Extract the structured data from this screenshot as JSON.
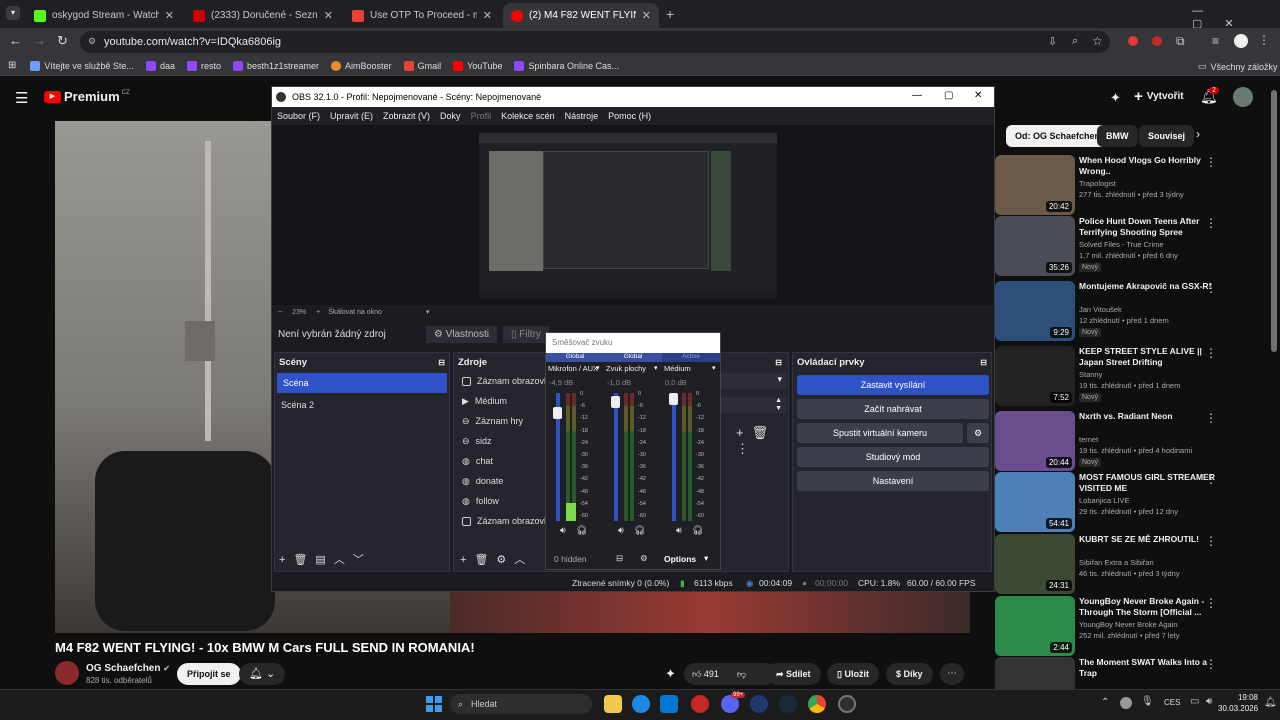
{
  "browser": {
    "tabs": [
      {
        "title": "oskygod Stream - Watch Live o",
        "color": "#53fc18",
        "active": false
      },
      {
        "title": "(2333) Doručené - Seznam Ema",
        "color": "#cc0000",
        "active": false
      },
      {
        "title": "Use OTP To Proceed - milandik",
        "color": "#ea4335",
        "active": false
      },
      {
        "title": "(2) M4 F82 WENT FLYING! - 10x",
        "color": "#ff0000",
        "active": true
      }
    ],
    "url": "youtube.com/watch?v=IDQka6806ig",
    "bookmarks": [
      {
        "label": "Vítejte ve službě Ste...",
        "color": "#6aa0ff"
      },
      {
        "label": "daa",
        "color": "#9146ff"
      },
      {
        "label": "resto",
        "color": "#9146ff"
      },
      {
        "label": "besth1z1streamer",
        "color": "#9146ff"
      },
      {
        "label": "AimBooster",
        "color": "#f28c28"
      },
      {
        "label": "Gmail",
        "color": "#ea4335"
      },
      {
        "label": "YouTube",
        "color": "#ff0000"
      },
      {
        "label": "Spinbara Online Cas...",
        "color": "#9146ff"
      }
    ],
    "all_bookmarks": "Všechny záložky"
  },
  "youtube": {
    "logo": "Premium",
    "logo_sup": "CZ",
    "create": "Vytvořit",
    "notif_count": "2",
    "chips": [
      "Od: OG Schaefchen",
      "BMW",
      "Souvisej"
    ],
    "video_title": "M4 F82 WENT FLYING! - 10x BMW M Cars FULL SEND IN ROMANIA!",
    "channel": "OG Schaefchen",
    "subscribers": "828 tis. odběratelů",
    "join": "Připojit se",
    "likes": "491",
    "share": "Sdílet",
    "save": "Uložit",
    "thanks": "Díky",
    "recommendations": [
      {
        "title": "When Hood Vlogs Go Horribly Wrong..",
        "channel": "Trapologist",
        "meta": "277 tis. zhlédnutí • před 3 týdny",
        "duration": "20:42",
        "badge": "",
        "color": "#6b5a4a"
      },
      {
        "title": "Police Hunt Down Teens After Terrifying Shooting Spree",
        "channel": "Solved Files - True Crime",
        "meta": "1,7 mil. zhlédnutí • před 6 dny",
        "duration": "35:26",
        "badge": "Nový",
        "color": "#4a4d55"
      },
      {
        "title": "Montujeme Akrapovič na GSX-R!",
        "channel": "Jan Vitoušek",
        "meta": "12 zhlédnutí • před 1 dnem",
        "duration": "9:29",
        "badge": "Nový",
        "color": "#2d4f7a"
      },
      {
        "title": "KEEP STREET STYLE ALIVE || Japan Street Drifting",
        "channel": "Stanny",
        "meta": "19 tis. zhlédnutí • před 1 dnem",
        "duration": "7:52",
        "badge": "Nový",
        "color": "#222"
      },
      {
        "title": "Nxrth vs. Radiant Neon",
        "channel": "ternet",
        "meta": "19 tis. zhlédnutí • před 4 hodinami",
        "duration": "20:44",
        "badge": "Nový",
        "color": "#6a4d8f"
      },
      {
        "title": "MOST FAMOUS GIRL STREAMER VISITED ME",
        "channel": "Lobanjica LIVE",
        "meta": "29 tis. zhlédnutí • před 12 dny",
        "duration": "54:41",
        "badge": "",
        "color": "#4e7fb8"
      },
      {
        "title": "KUBRT SE ZE MĚ ZHROUTIL!",
        "channel": "Sibiřan Extra a Sibiřan",
        "meta": "46 tis. zhlédnutí • před 3 týdny",
        "duration": "24:31",
        "badge": "",
        "color": "#3c4a35"
      },
      {
        "title": "YoungBoy Never Broke Again - Through The Storm [Official ...",
        "channel": "YoungBoy Never Broke Again",
        "meta": "252 mil. zhlédnutí • před 7 lety",
        "duration": "2:44",
        "badge": "",
        "color": "#2c8a4a"
      },
      {
        "title": "The Moment SWAT Walks Into a Trap",
        "channel": "",
        "meta": "",
        "duration": "",
        "badge": "",
        "color": "#333"
      }
    ]
  },
  "obs": {
    "title": "OBS 32.1.0 - Profil: Nepojmenované - Scény: Nepojmenované",
    "menu": [
      "Soubor (F)",
      "Upravit (E)",
      "Zobrazit (V)",
      "Doky",
      "Profil",
      "Kolekce scén",
      "Nástroje",
      "Pomoc (H)"
    ],
    "zoom": "23%",
    "scale_mode": "Škálovat na okno",
    "no_source": "Není vybrán žádný zdroj",
    "properties": "Vlastnosti",
    "filters": "Filtry",
    "scenes_title": "Scény",
    "scenes": [
      "Scéna",
      "Scéna 2"
    ],
    "sources_title": "Zdroje",
    "sources": [
      "Záznam obrazovk",
      "Médium",
      "Záznam hry",
      "sidz",
      "chat",
      "donate",
      "follow",
      "Záznam obrazovk"
    ],
    "controls_title": "Ovládací prvky",
    "controls": [
      "Zastavit vysílání",
      "Začít nahrávat",
      "Spustit virtuální kameru",
      "Studiový mód",
      "Nastavení"
    ],
    "mixer": {
      "title": "Směšovač zvuku",
      "channels": [
        {
          "tag": "Global",
          "name": "Mikrofon / AUX",
          "db": "-4,9 dB",
          "level": 0.82
        },
        {
          "tag": "Global",
          "name": "Zvuk plochy",
          "db": "-1,0 dB",
          "level": 0.96
        },
        {
          "tag": "Active",
          "name": "Médium",
          "db": "0,0 dB",
          "level": 1.0
        }
      ],
      "scale": [
        "0",
        "-6",
        "-12",
        "-18",
        "-24",
        "-30",
        "-36",
        "-42",
        "-48",
        "-54",
        "-60"
      ],
      "hidden": "0 hidden",
      "options": "Options"
    },
    "status": {
      "dropped": "Ztracené snímky 0 (0.0%)",
      "bitrate": "6113 kbps",
      "stream_time": "00:04:09",
      "rec_time": "00:00:00",
      "cpu": "CPU: 1.8%",
      "fps": "60.00 / 60.00 FPS"
    }
  },
  "taskbar": {
    "search": "Hledat",
    "lang": "CES",
    "time": "19:08",
    "date": "30.03.2026",
    "badge": "99+"
  }
}
